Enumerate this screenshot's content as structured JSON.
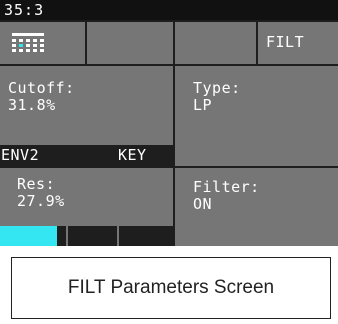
{
  "status_bar": {
    "text": "35:3"
  },
  "top_row": {
    "grid_icon": "sequencer-grid-icon",
    "filt_label": "FILT"
  },
  "params": {
    "cutoff": {
      "label": "Cutoff:",
      "value": "31.8%"
    },
    "type": {
      "label": "Type:",
      "value": "LP"
    },
    "res": {
      "label": "Res:",
      "value": "27.9%",
      "level": 0.33
    },
    "filter": {
      "label": "Filter:",
      "value": "ON"
    }
  },
  "mod_bar": {
    "env": "ENV2",
    "key": "KEY"
  },
  "caption": "FILT Parameters Screen",
  "colors": {
    "screen_bg": "#1e1e1e",
    "cell_bg": "#767676",
    "accent": "#33e6f2",
    "text": "#ffffff"
  }
}
